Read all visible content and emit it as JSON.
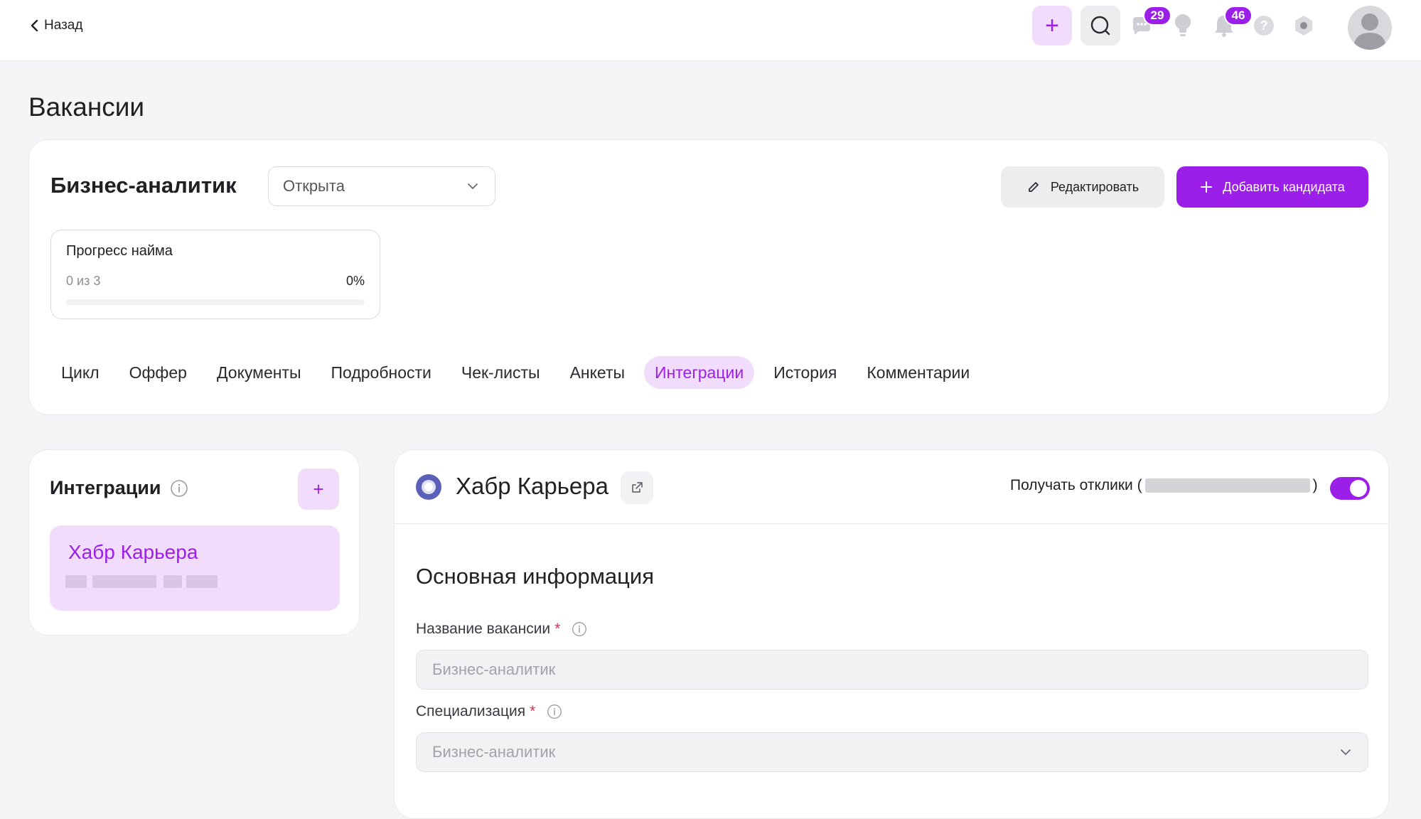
{
  "topbar": {
    "back_label": "Назад",
    "chat_badge": "29",
    "notifications_badge": "46",
    "plus_label": "+",
    "help_label": "?"
  },
  "page": {
    "title": "Вакансии"
  },
  "vacancy": {
    "name": "Бизнес-аналитик",
    "status": "Открыта",
    "edit_label": "Редактировать",
    "add_candidate_label": "Добавить кандидата"
  },
  "progress": {
    "title": "Прогресс найма",
    "count": "0 из 3",
    "percent_label": "0%",
    "value": 0
  },
  "tabs": [
    {
      "label": "Цикл",
      "active": false
    },
    {
      "label": "Оффер",
      "active": false
    },
    {
      "label": "Документы",
      "active": false
    },
    {
      "label": "Подробности",
      "active": false
    },
    {
      "label": "Чек-листы",
      "active": false
    },
    {
      "label": "Анкеты",
      "active": false
    },
    {
      "label": "Интеграции",
      "active": true
    },
    {
      "label": "История",
      "active": false
    },
    {
      "label": "Комментарии",
      "active": false
    }
  ],
  "integrations": {
    "title": "Интеграции",
    "add_label": "+",
    "items": [
      {
        "title": "Хабр Карьера"
      }
    ]
  },
  "details": {
    "title": "Хабр Карьера",
    "receive_label": "Получать отклики (",
    "receive_label_end": ")",
    "receive_enabled": true,
    "section_title": "Основная информация",
    "fields": {
      "vacancy_name_label": "Название вакансии",
      "vacancy_name_value": "Бизнес-аналитик",
      "specialization_label": "Специализация",
      "specialization_value": "Бизнес-аналитик",
      "required_mark": "*"
    }
  },
  "colors": {
    "accent": "#9b1fe8",
    "accent_soft": "#f2dcfc",
    "required": "#e02d4a"
  }
}
